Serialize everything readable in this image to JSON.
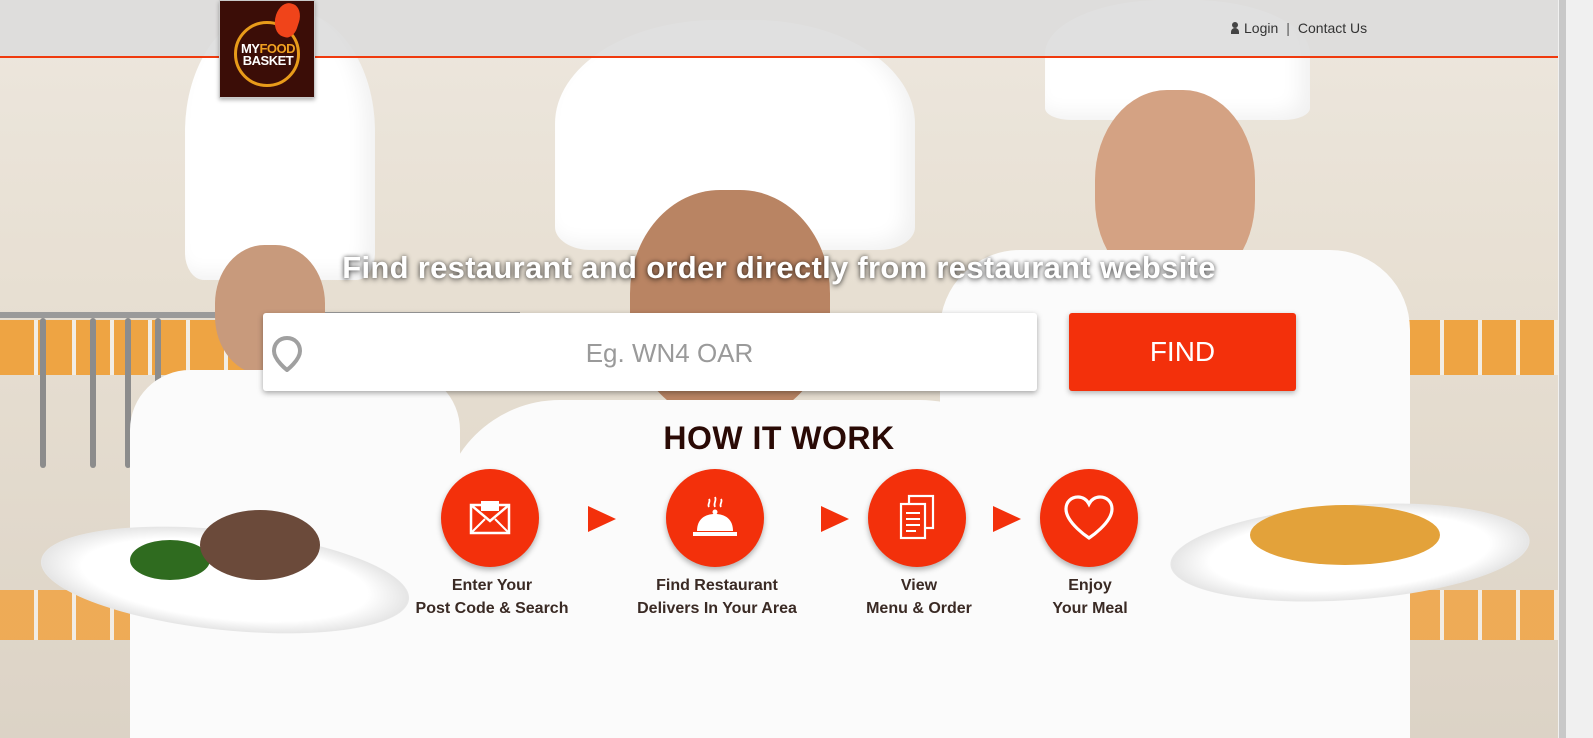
{
  "header": {
    "logo": {
      "line1_a": "MY",
      "line1_b": "FOOD",
      "line2": "BASKET"
    },
    "nav": {
      "login": "Login",
      "separator": "|",
      "contact": "Contact Us"
    }
  },
  "hero": {
    "title": "Find restaurant and order directly from restaurant website",
    "search_placeholder": "Eg. WN4 OAR",
    "search_value": "",
    "find_label": "FIND"
  },
  "how_it_works": {
    "title": "HOW IT WORK",
    "steps": [
      {
        "icon": "zip-envelope-icon",
        "line1": "Enter Your",
        "line2": "Post Code & Search"
      },
      {
        "icon": "cloche-icon",
        "line1": "Find Restaurant",
        "line2": "Delivers In Your Area"
      },
      {
        "icon": "menu-documents-icon",
        "line1": "View",
        "line2": "Menu & Order"
      },
      {
        "icon": "heart-icon",
        "line1": "Enjoy",
        "line2": "Your Meal"
      }
    ]
  },
  "colors": {
    "accent": "#f3300b",
    "logo_bg": "#3b0d07",
    "heading_dark": "#2a0a05"
  }
}
